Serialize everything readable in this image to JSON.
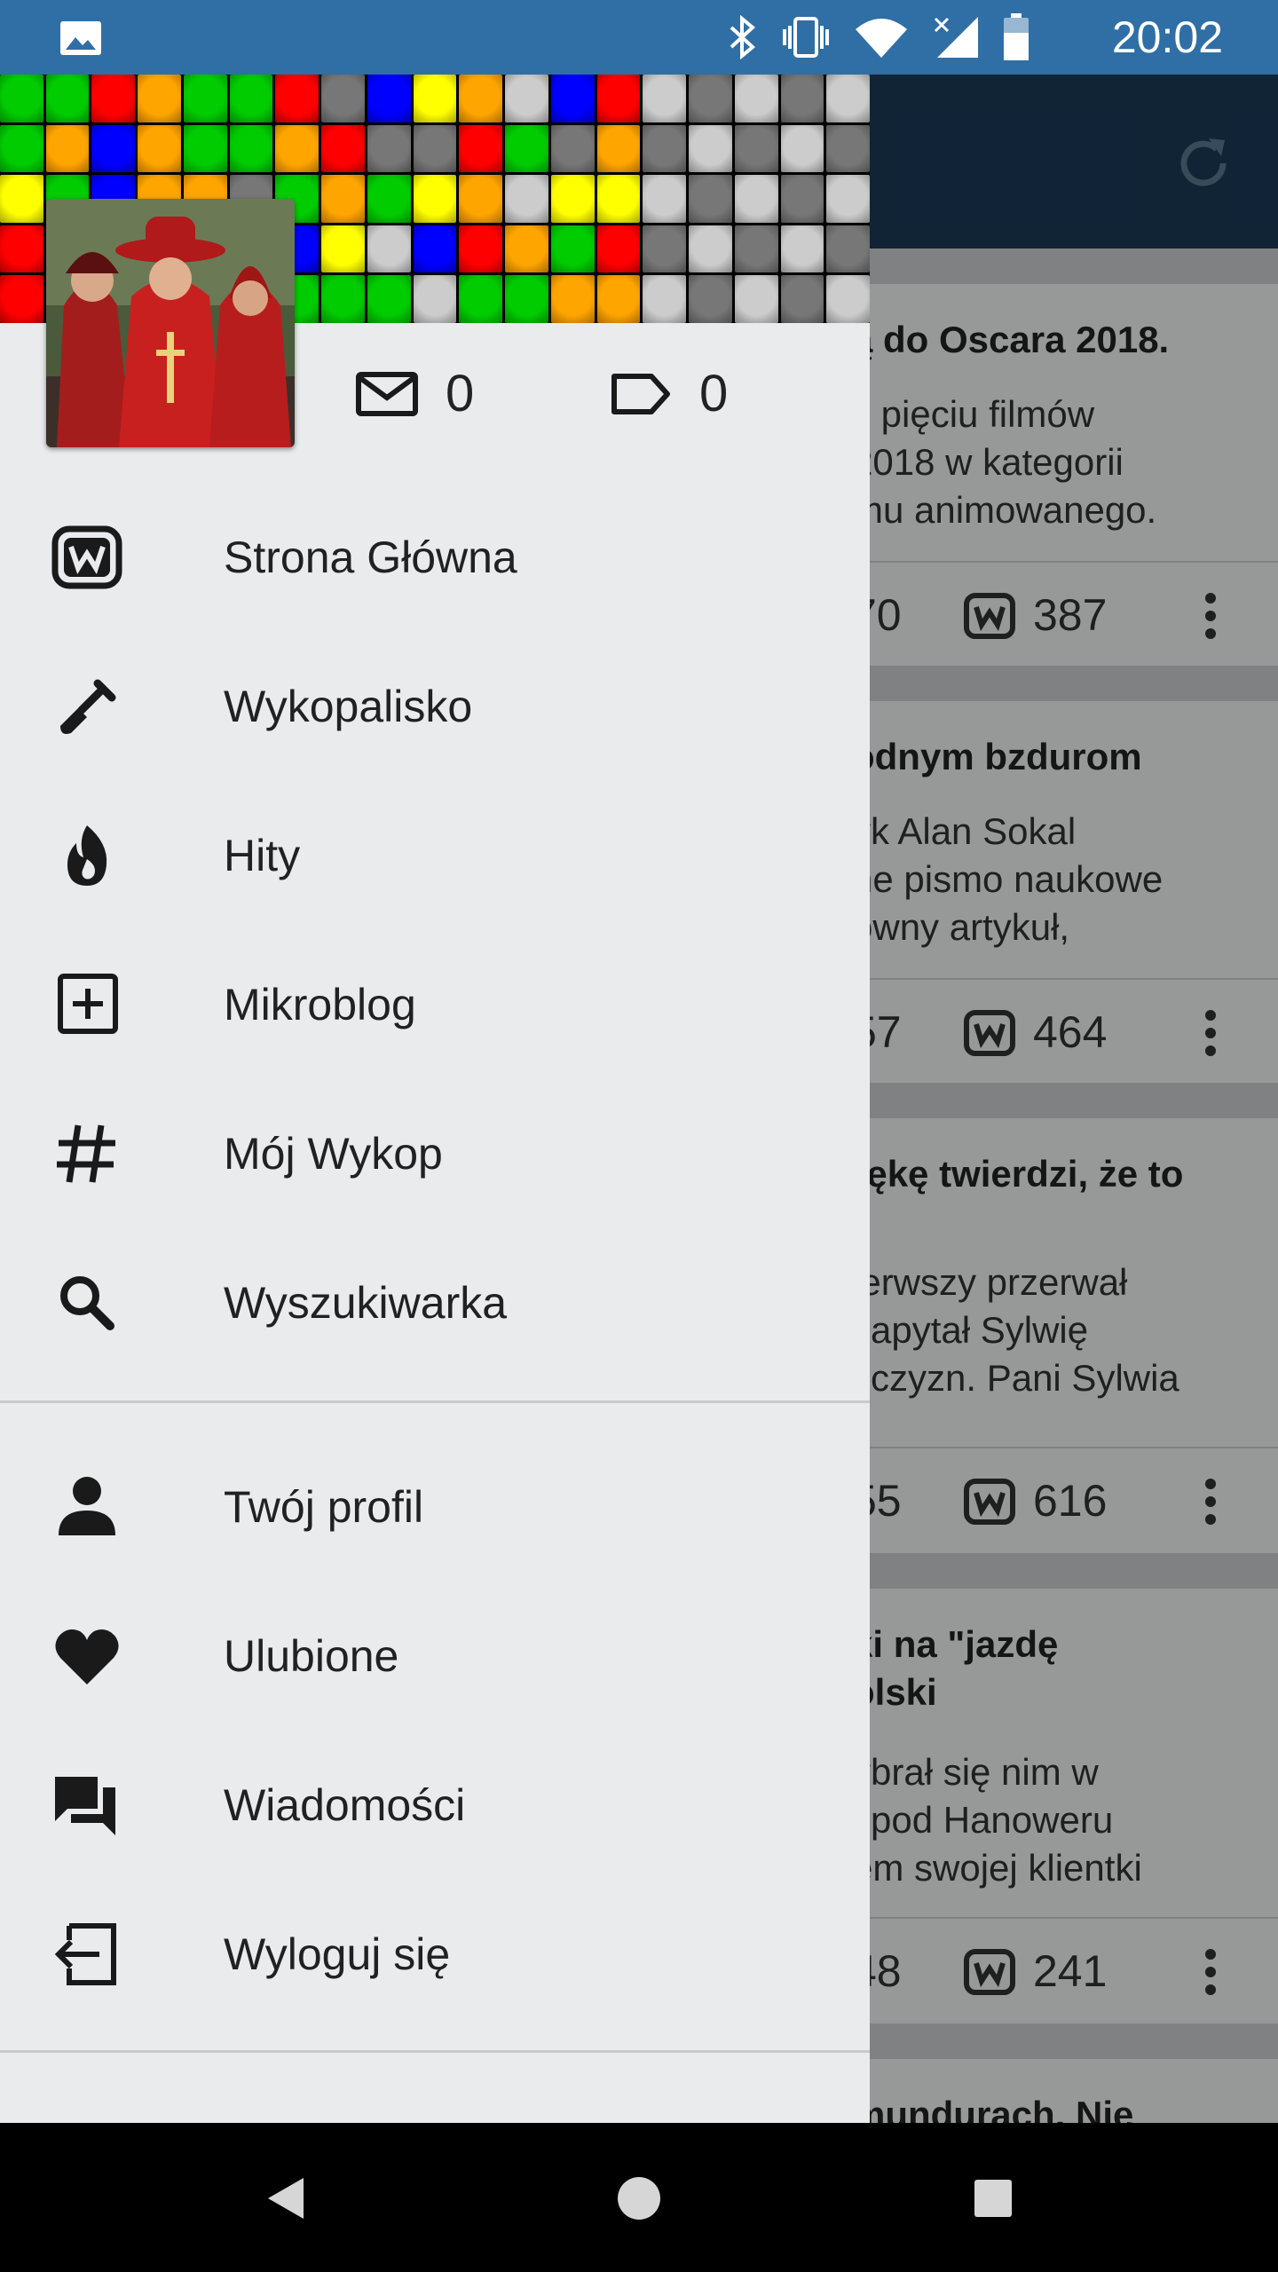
{
  "status_bar": {
    "time": "20:02",
    "icons": [
      "image-icon",
      "bluetooth-icon",
      "vibrate-icon",
      "wifi-icon",
      "signal-icon",
      "battery-icon"
    ]
  },
  "header": {
    "message_count": "0",
    "tag_count": "0"
  },
  "menu": {
    "primary": [
      {
        "label": "Strona Główna",
        "icon": "wykop-logo-icon"
      },
      {
        "label": "Wykopalisko",
        "icon": "shovel-icon"
      },
      {
        "label": "Hity",
        "icon": "flame-icon"
      },
      {
        "label": "Mikroblog",
        "icon": "plus-box-icon"
      },
      {
        "label": "Mój Wykop",
        "icon": "hashtag-icon"
      },
      {
        "label": "Wyszukiwarka",
        "icon": "search-icon"
      }
    ],
    "secondary": [
      {
        "label": "Twój profil",
        "icon": "person-icon"
      },
      {
        "label": "Ulubione",
        "icon": "heart-icon"
      },
      {
        "label": "Wiadomości",
        "icon": "forum-icon"
      },
      {
        "label": "Wyloguj się",
        "icon": "logout-icon"
      }
    ]
  },
  "feed": {
    "cards": [
      {
        "title": "ą do Oscara 2018.",
        "desc": "z pięciu filmów\n2018 w kategorii\nmu animowanego.",
        "left_count": "70",
        "votes": "387"
      },
      {
        "title": "odnym bzdurom",
        "desc": "yk Alan Sokal\nne pismo naukowe\nowny artykuł,",
        "left_count": "57",
        "votes": "464"
      },
      {
        "title": "rękę twierdzi, że to",
        "desc": "ierwszy przerwał\nzapytał Sylwię\nżczyzn. Pani Sylwia",
        "left_count": "55",
        "votes": "616"
      },
      {
        "title": "ki na \"jazdę\nolski",
        "desc": "ybrał się nim w\nspod Hanoweru\nem swojej klientki",
        "left_count": "48",
        "votes": "241"
      },
      {
        "title": "mundurach. Nie",
        "desc": "",
        "left_count": "",
        "votes": ""
      }
    ]
  },
  "colors": {
    "status_bar": "#2f6fa6",
    "app_bar": "#1b3a58",
    "drawer_bg": "#e9ebed",
    "mosaic": [
      "#ff0000",
      "#ffa500",
      "#ffff00",
      "#00cc00",
      "#0000ff",
      "#cccccc",
      "#777777"
    ]
  },
  "nav_bar": {
    "buttons": [
      "back-icon",
      "home-icon",
      "recents-icon"
    ]
  }
}
